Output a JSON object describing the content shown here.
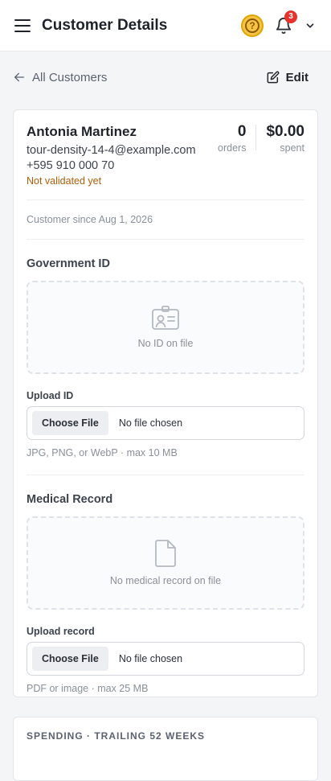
{
  "header": {
    "title": "Customer Details",
    "help_icon": "question-circle-icon",
    "notifications_count": "3"
  },
  "subnav": {
    "back_label": "All Customers",
    "edit_label": "Edit"
  },
  "customer": {
    "name": "Antonia Martinez",
    "email": "tour-density-14-4@example.com",
    "phone": "+595 910 000 70",
    "status": "Not validated yet",
    "since": "Customer since Aug 1, 2026",
    "orders_value": "0",
    "orders_label": "orders",
    "spent_value": "$0.00",
    "spent_label": "spent"
  },
  "government_id": {
    "title": "Government ID",
    "empty_text": "No ID on file",
    "upload_label": "Upload ID",
    "choose_label": "Choose File",
    "no_file": "No file chosen",
    "hint": "JPG, PNG, or WebP · max 10 MB"
  },
  "medical_record": {
    "title": "Medical Record",
    "empty_text": "No medical record on file",
    "upload_label": "Upload record",
    "choose_label": "Choose File",
    "no_file": "No file chosen",
    "hint": "PDF or image · max 25 MB"
  },
  "spending": {
    "title": "SPENDING · TRAILING 52 WEEKS"
  },
  "colors": {
    "warning_text": "#b25e09",
    "badge": "#e5322d",
    "help_accent": "#f6c343"
  }
}
